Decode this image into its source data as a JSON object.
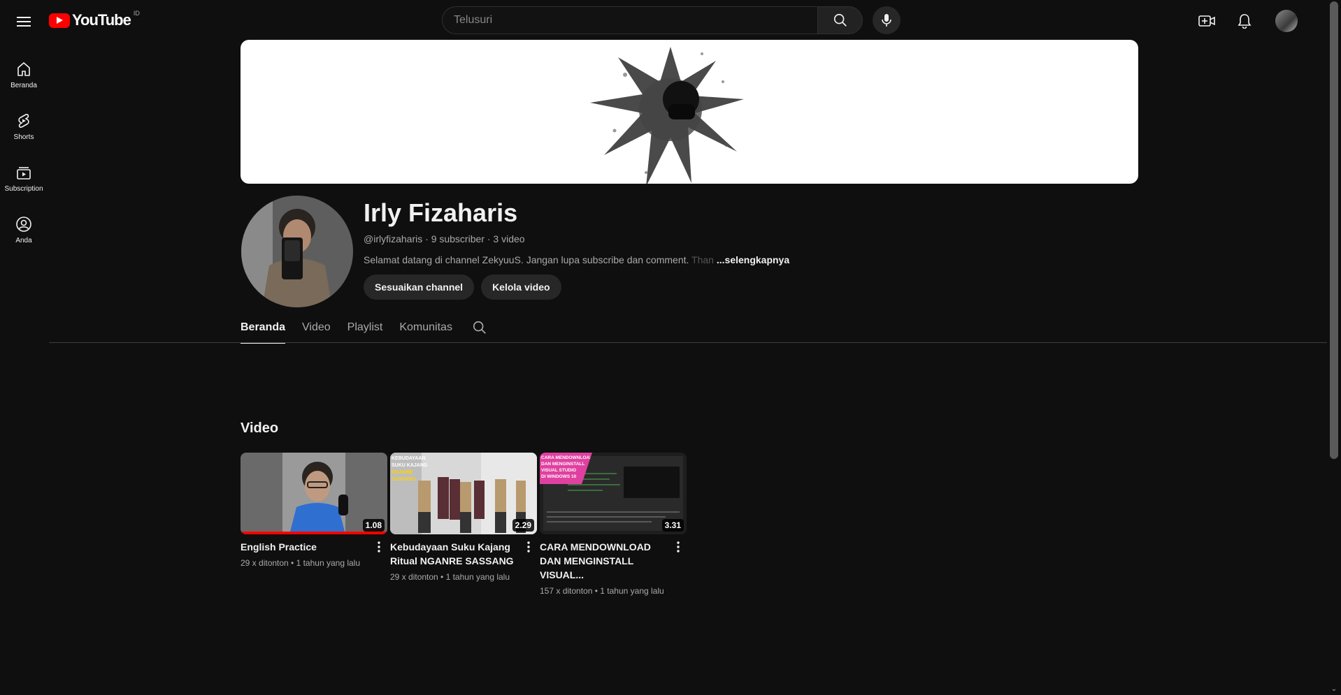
{
  "header": {
    "logo_text": "YouTube",
    "country_code": "ID",
    "search_placeholder": "Telusuri"
  },
  "sidebar": {
    "items": [
      {
        "label": "Beranda",
        "icon": "home-icon"
      },
      {
        "label": "Shorts",
        "icon": "shorts-icon"
      },
      {
        "label": "Subscription",
        "icon": "subscriptions-icon"
      },
      {
        "label": "Anda",
        "icon": "account-icon"
      }
    ]
  },
  "channel": {
    "name": "Irly Fizaharis",
    "handle": "@irlyfizaharis",
    "subscribers": "9 subscriber",
    "videos": "3 video",
    "description": "Selamat datang di channel ZekyuuS. Jangan lupa subscribe dan comment. ",
    "description_fade": "Than",
    "more_label": "...selengkapnya",
    "customize_label": "Sesuaikan channel",
    "manage_label": "Kelola video"
  },
  "tabs": [
    {
      "label": "Beranda",
      "active": true
    },
    {
      "label": "Video",
      "active": false
    },
    {
      "label": "Playlist",
      "active": false
    },
    {
      "label": "Komunitas",
      "active": false
    }
  ],
  "videos_section": {
    "title": "Video",
    "items": [
      {
        "title": "English Practice",
        "duration": "1.08",
        "views": "29 x ditonton",
        "age": "1 tahun yang lalu",
        "watched_fraction": 1.0
      },
      {
        "title": "Kebudayaan Suku Kajang Ritual NGANRE SASSANG",
        "duration": "2.29",
        "views": "29 x ditonton",
        "age": "1 tahun yang lalu",
        "thumb_text": "KEBUDAYAAN SUKU KAJANG NGANRE SASSANG"
      },
      {
        "title": "CARA MENDOWNLOAD DAN MENGINSTALL VISUAL...",
        "duration": "3.31",
        "views": "157 x ditonton",
        "age": "1 tahun yang lalu",
        "thumb_text": "CARA MENDOWNLOAD DAN MENGINSTALL VISUAL STUDIO DI WINDOWS 10"
      }
    ]
  },
  "colors": {
    "background": "#0f0f0f",
    "brand_red": "#ff0000",
    "text_primary": "#f1f1f1",
    "text_secondary": "#aaaaaa"
  }
}
